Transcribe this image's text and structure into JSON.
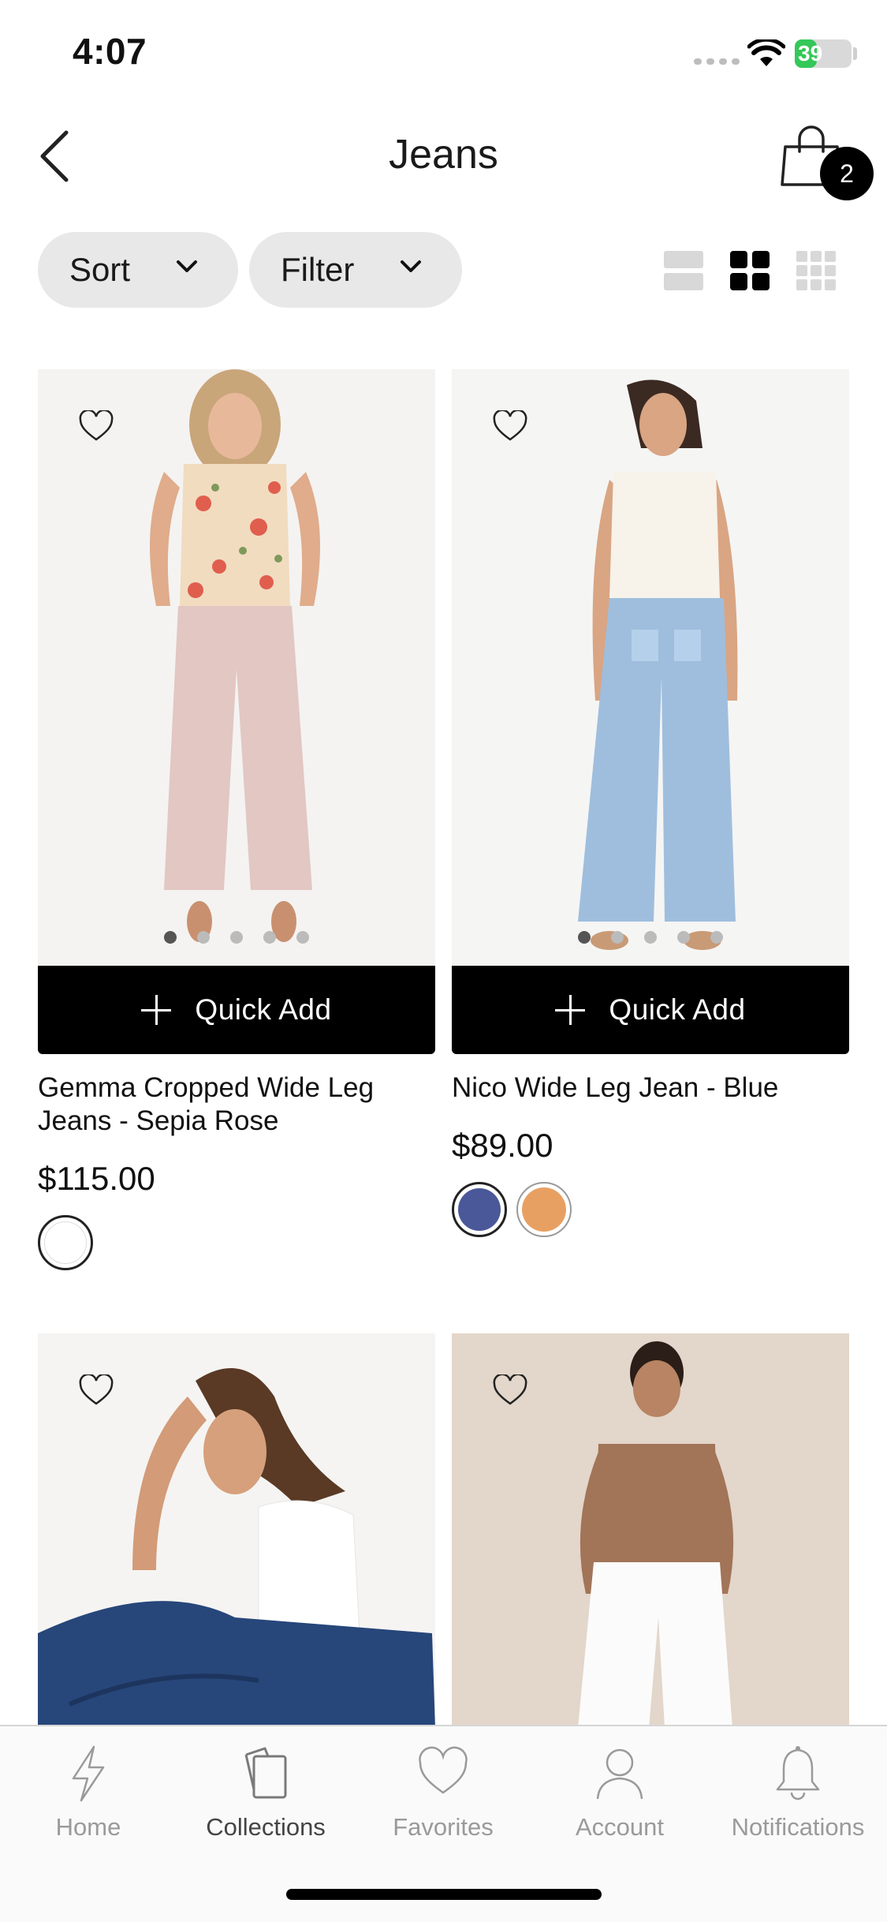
{
  "status_bar": {
    "time": "4:07",
    "battery": "39",
    "battery_level": 0.39
  },
  "header": {
    "title": "Jeans",
    "cart_count": "2"
  },
  "toolbar": {
    "sort_label": "Sort",
    "filter_label": "Filter",
    "view_modes": [
      "list",
      "grid-2",
      "grid-3"
    ],
    "active_view": "grid-2"
  },
  "products": [
    {
      "name": "Gemma Cropped Wide Leg Jeans - Sepia Rose",
      "price": "$115.00",
      "quick_add": "Quick Add",
      "image_dots": 5,
      "active_dot": 0,
      "swatches": [
        "#ffffff"
      ]
    },
    {
      "name": "Nico Wide Leg Jean - Blue",
      "price": "$89.00",
      "quick_add": "Quick Add",
      "image_dots": 5,
      "active_dot": 0,
      "swatches": [
        "#4a5899",
        "#e8a062"
      ]
    },
    {
      "name": "",
      "price": ""
    },
    {
      "name": "",
      "price": ""
    }
  ],
  "tab_bar": {
    "items": [
      {
        "label": "Home",
        "icon": "bolt-icon"
      },
      {
        "label": "Collections",
        "icon": "collections-icon"
      },
      {
        "label": "Favorites",
        "icon": "heart-icon"
      },
      {
        "label": "Account",
        "icon": "user-icon"
      },
      {
        "label": "Notifications",
        "icon": "bell-icon"
      }
    ],
    "active": "Collections"
  },
  "colors": {
    "accent": "#000000",
    "pill_bg": "#e8e8e8",
    "inactive_tab": "#9a9a9a",
    "battery": "#34c759"
  }
}
